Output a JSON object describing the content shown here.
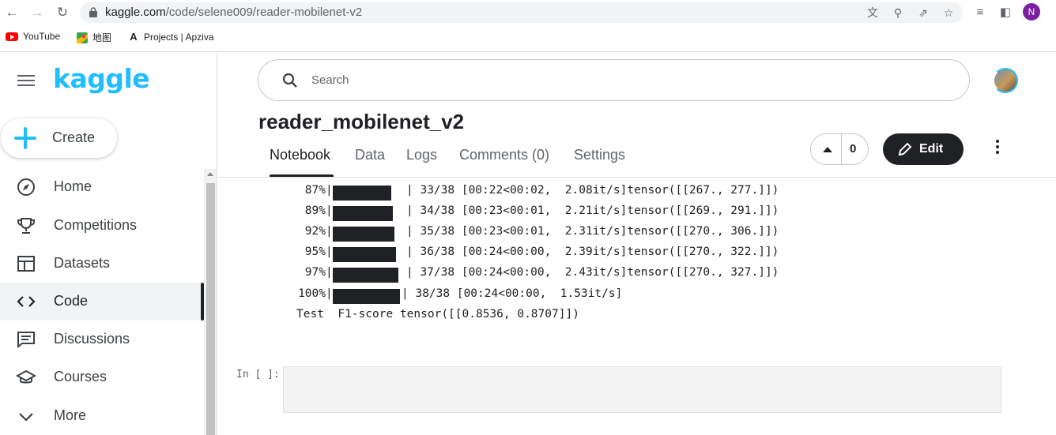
{
  "browser": {
    "url_host": "kaggle.com",
    "url_path": "/code/selene009/reader-mobilenet-v2",
    "profile_initial": "N",
    "bookmarks": [
      {
        "label": "YouTube",
        "icon": "youtube-icon"
      },
      {
        "label": "地图",
        "icon": "maps-icon"
      },
      {
        "label": "Projects | Apziva",
        "icon": "apziva-icon"
      }
    ]
  },
  "sidebar": {
    "logo": "kaggle",
    "create_label": "Create",
    "items": [
      {
        "label": "Home",
        "icon": "compass-icon"
      },
      {
        "label": "Competitions",
        "icon": "trophy-icon"
      },
      {
        "label": "Datasets",
        "icon": "table-icon"
      },
      {
        "label": "Code",
        "icon": "code-icon",
        "active": true
      },
      {
        "label": "Discussions",
        "icon": "chat-icon"
      },
      {
        "label": "Courses",
        "icon": "school-icon"
      },
      {
        "label": "More",
        "icon": "chevron-down-icon"
      }
    ]
  },
  "header": {
    "search_placeholder": "Search"
  },
  "notebook": {
    "title": "reader_mobilenet_v2",
    "tabs": [
      "Notebook",
      "Data",
      "Logs",
      "Comments (0)",
      "Settings"
    ],
    "active_tab": "Notebook",
    "vote_count": "0",
    "edit_label": "Edit"
  },
  "output": {
    "progress_lines": [
      {
        "pct": "87%",
        "fraction": 0.868,
        "text": "| 33/38 [00:22<00:02,  2.08it/s]tensor([[267., 277.]])"
      },
      {
        "pct": "89%",
        "fraction": 0.895,
        "text": "| 34/38 [00:23<00:01,  2.21it/s]tensor([[269., 291.]])"
      },
      {
        "pct": "92%",
        "fraction": 0.921,
        "text": "| 35/38 [00:23<00:01,  2.31it/s]tensor([[270., 306.]])"
      },
      {
        "pct": "95%",
        "fraction": 0.947,
        "text": "| 36/38 [00:24<00:00,  2.39it/s]tensor([[270., 322.]])"
      },
      {
        "pct": "97%",
        "fraction": 0.974,
        "text": "| 37/38 [00:24<00:00,  2.43it/s]tensor([[270., 327.]])"
      }
    ],
    "final_line": {
      "pct": "100%",
      "fraction": 1.0,
      "text": "| 38/38 [00:24<00:00,  1.53it/s]"
    },
    "score_line": "Test  F1-score tensor([[0.8536, 0.8707]])"
  },
  "empty_cell": {
    "prompt": "In [ ]:"
  }
}
